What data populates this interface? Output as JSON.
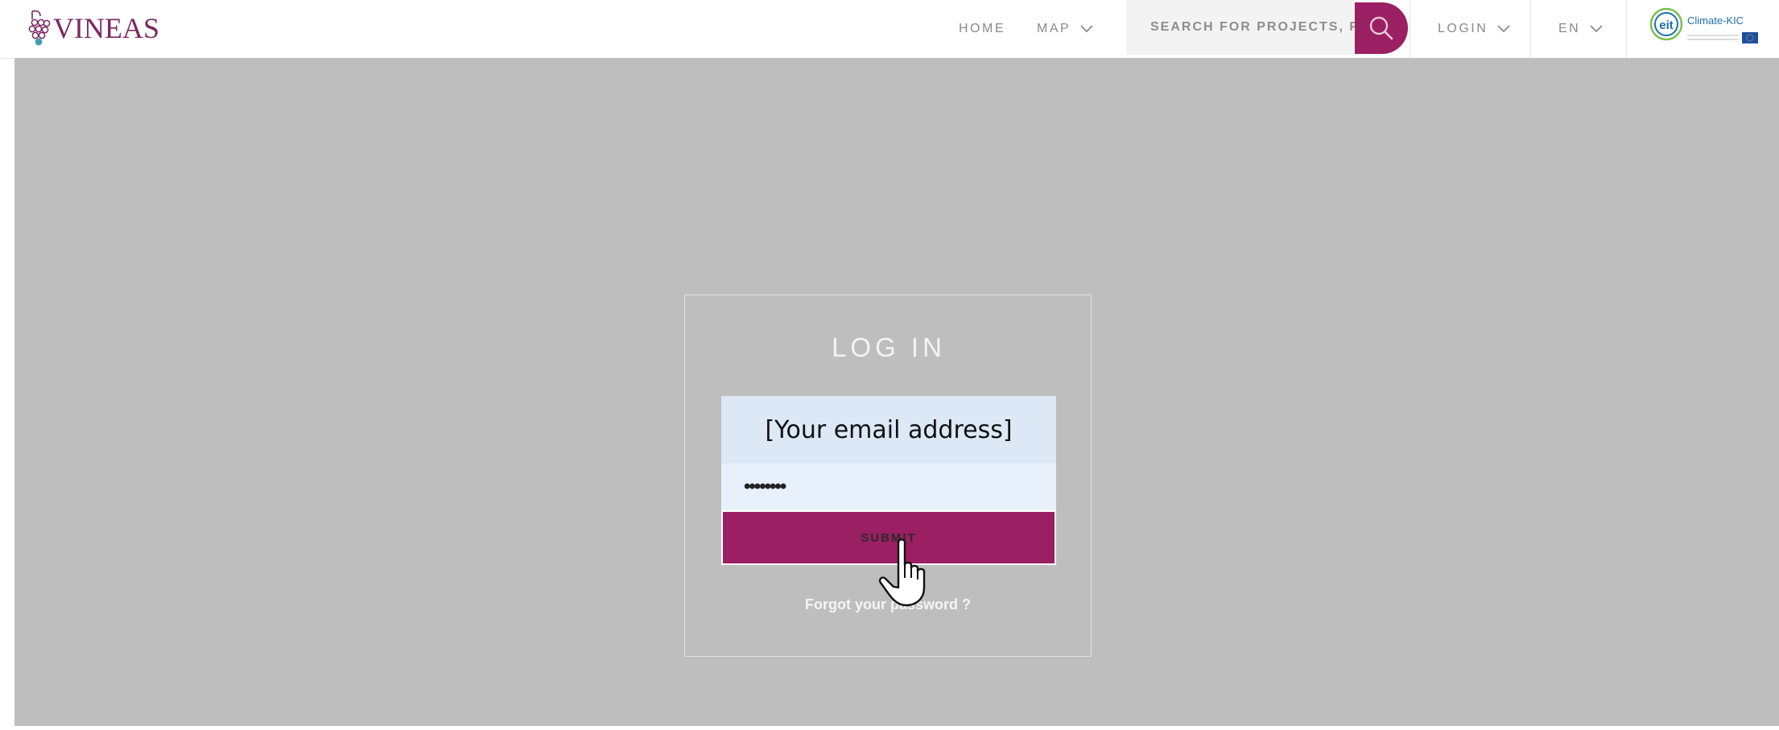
{
  "brand": {
    "logo_text": "VINEAS",
    "color": "#7a2862",
    "accent": "#9b1f63"
  },
  "nav": {
    "home": "HOME",
    "map": "MAP",
    "search_placeholder": "SEARCH FOR PROJECTS, PL",
    "login": "LOGIN",
    "language": "EN"
  },
  "partner_logo": {
    "eit": "eit",
    "name": "Climate-KIC"
  },
  "login": {
    "title": "LOG IN",
    "email_value": "[Your email address]",
    "password_value": "••••••••",
    "submit_label": "SUBMIT",
    "forgot_label": "Forgot your password ?"
  },
  "icons": {
    "logo": "grape-cluster-icon",
    "dropdown": "chevron-down-icon",
    "search": "search-icon",
    "cursor": "hand-pointer-icon"
  }
}
